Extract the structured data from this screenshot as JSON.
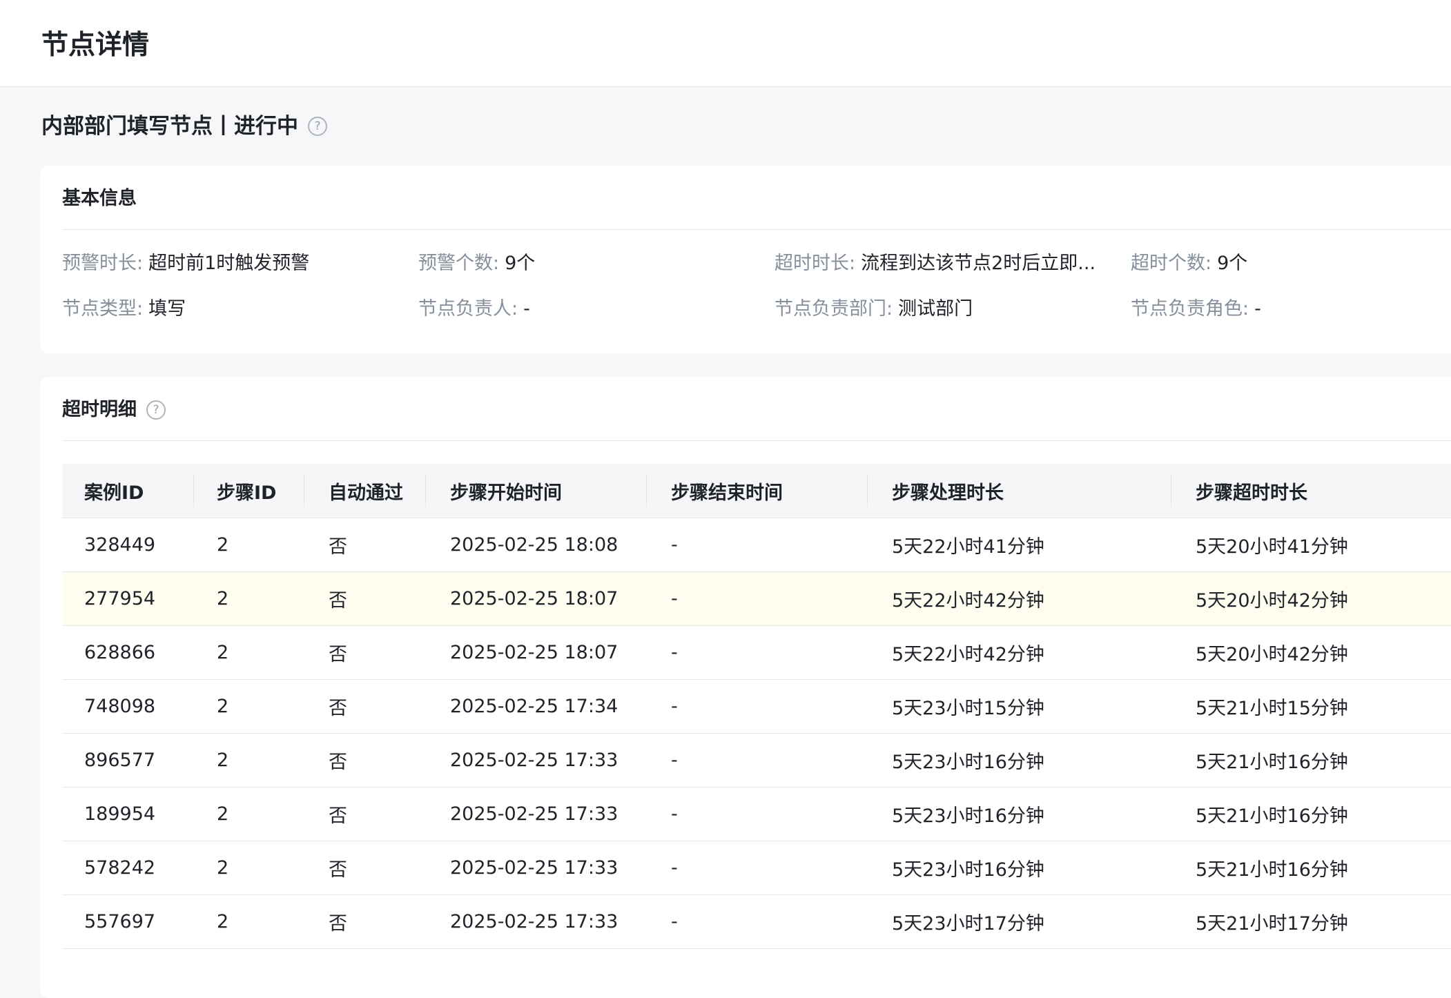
{
  "page": {
    "title": "节点详情"
  },
  "node": {
    "title": "内部部门填写节点丨进行中",
    "help_icon": "question-circle-icon"
  },
  "basic_info": {
    "title": "基本信息",
    "items": [
      {
        "label": "预警时长:",
        "value": "超时前1时触发预警"
      },
      {
        "label": "预警个数:",
        "value": "9个"
      },
      {
        "label": "超时时长:",
        "value": "流程到达该节点2时后立即..."
      },
      {
        "label": "超时个数:",
        "value": "9个"
      },
      {
        "label": "节点类型:",
        "value": "填写"
      },
      {
        "label": "节点负责人:",
        "value": "-"
      },
      {
        "label": "节点负责部门:",
        "value": "测试部门"
      },
      {
        "label": "节点负责角色:",
        "value": "-"
      }
    ]
  },
  "timeout_detail": {
    "title": "超时明细",
    "help_icon": "question-circle-icon",
    "columns": [
      "案例ID",
      "步骤ID",
      "自动通过",
      "步骤开始时间",
      "步骤结束时间",
      "步骤处理时长",
      "步骤超时时长"
    ],
    "rows": [
      [
        "328449",
        "2",
        "否",
        "2025-02-25 18:08",
        "-",
        "5天22小时41分钟",
        "5天20小时41分钟"
      ],
      [
        "277954",
        "2",
        "否",
        "2025-02-25 18:07",
        "-",
        "5天22小时42分钟",
        "5天20小时42分钟"
      ],
      [
        "628866",
        "2",
        "否",
        "2025-02-25 18:07",
        "-",
        "5天22小时42分钟",
        "5天20小时42分钟"
      ],
      [
        "748098",
        "2",
        "否",
        "2025-02-25 17:34",
        "-",
        "5天23小时15分钟",
        "5天21小时15分钟"
      ],
      [
        "896577",
        "2",
        "否",
        "2025-02-25 17:33",
        "-",
        "5天23小时16分钟",
        "5天21小时16分钟"
      ],
      [
        "189954",
        "2",
        "否",
        "2025-02-25 17:33",
        "-",
        "5天23小时16分钟",
        "5天21小时16分钟"
      ],
      [
        "578242",
        "2",
        "否",
        "2025-02-25 17:33",
        "-",
        "5天23小时16分钟",
        "5天21小时16分钟"
      ],
      [
        "557697",
        "2",
        "否",
        "2025-02-25 17:33",
        "-",
        "5天23小时17分钟",
        "5天21小时17分钟"
      ]
    ]
  }
}
